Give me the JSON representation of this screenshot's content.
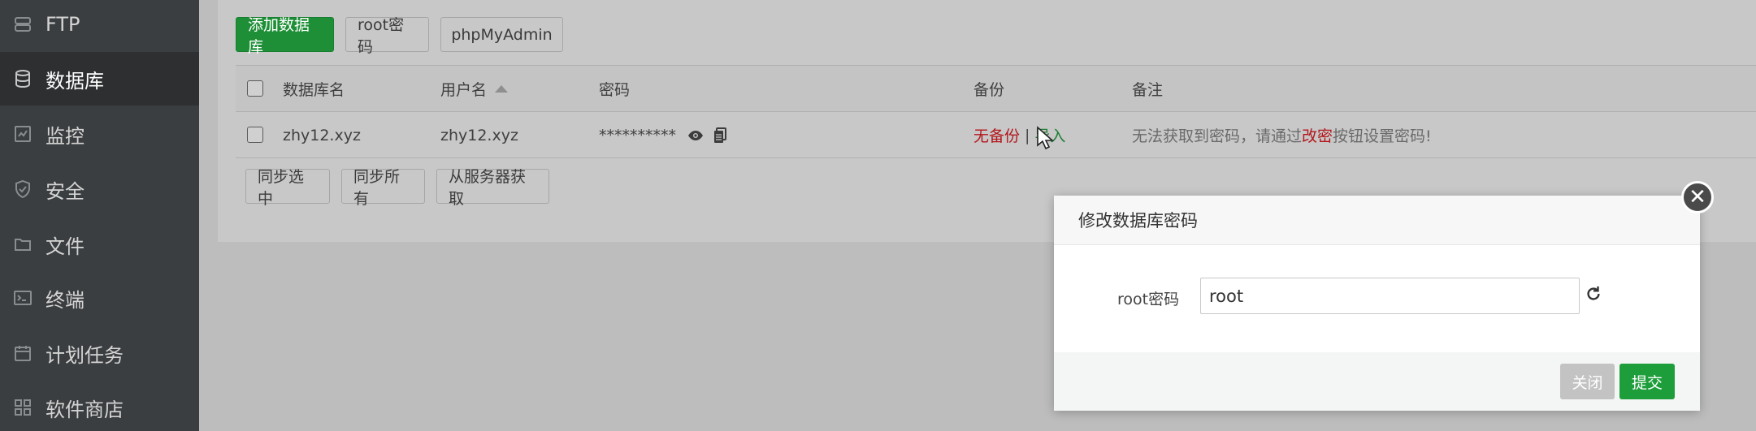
{
  "sidebar": {
    "items": [
      {
        "label": "FTP",
        "icon": "ftp-icon"
      },
      {
        "label": "数据库",
        "icon": "database-icon",
        "active": true
      },
      {
        "label": "监控",
        "icon": "monitor-icon"
      },
      {
        "label": "安全",
        "icon": "shield-icon"
      },
      {
        "label": "文件",
        "icon": "folder-icon"
      },
      {
        "label": "终端",
        "icon": "terminal-icon"
      },
      {
        "label": "计划任务",
        "icon": "calendar-icon"
      },
      {
        "label": "软件商店",
        "icon": "apps-icon"
      }
    ]
  },
  "toolbar": {
    "add_db": "添加数据库",
    "root_pwd": "root密码",
    "phpmyadmin": "phpMyAdmin"
  },
  "table": {
    "headers": {
      "name": "数据库名",
      "user": "用户名",
      "password": "密码",
      "backup": "备份",
      "note": "备注"
    },
    "rows": [
      {
        "name": "zhy12.xyz",
        "user": "zhy12.xyz",
        "password": "**********",
        "backup_none": "无备份",
        "separator": "|",
        "import": "导入",
        "note_pre": "无法获取到密码，请通过",
        "note_link": "改密",
        "note_post": "按钮设置密码!"
      }
    ]
  },
  "actions": {
    "sync_selected": "同步选中",
    "sync_all": "同步所有",
    "fetch_server": "从服务器获取"
  },
  "modal": {
    "title": "修改数据库密码",
    "field_label": "root密码",
    "field_value": "root",
    "close": "关闭",
    "submit": "提交",
    "close_x": "✕"
  },
  "colors": {
    "accent_green": "#1e8f37",
    "danger_red": "#b3161b",
    "sidebar_bg": "#3b3e40"
  }
}
